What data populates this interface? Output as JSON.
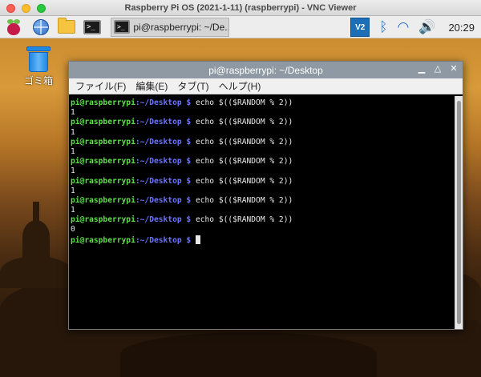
{
  "vnc": {
    "title": "Raspberry Pi OS (2021-1-11) (raspberrypi) - VNC Viewer"
  },
  "panel": {
    "icons": [
      "raspberry-menu-icon",
      "browser-globe-icon",
      "file-manager-folder-icon",
      "terminal-icon"
    ],
    "taskbar_label": "pi@raspberrypi: ~/De...",
    "vnc_tray_label": "V2",
    "clock": "20:29"
  },
  "desktop": {
    "trash_label": "ゴミ箱"
  },
  "terminal": {
    "title": "pi@raspberrypi: ~/Desktop",
    "menu": [
      "ファイル(F)",
      "編集(E)",
      "タブ(T)",
      "ヘルプ(H)"
    ],
    "prompt_user": "pi@raspberrypi",
    "prompt_path": ":~/Desktop $ ",
    "command": "echo $(($RANDOM % 2))",
    "outputs": [
      "1",
      "1",
      "1",
      "1",
      "1",
      "1",
      "0"
    ]
  },
  "colors": {
    "prompt_user": "#5ee04a",
    "prompt_path": "#6c73ff",
    "terminal_bg": "#000000",
    "titlebar": "#8e99a3"
  }
}
